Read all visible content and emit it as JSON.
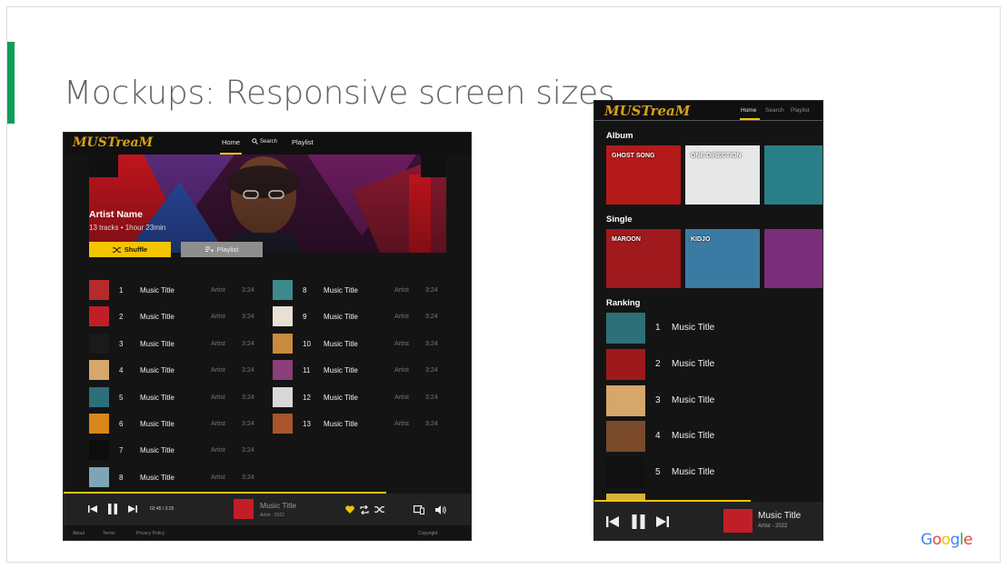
{
  "slide": {
    "title": "Mockups: Responsive screen sizes",
    "accent_color": "#0f9d58",
    "google_logo": "Google"
  },
  "desktop": {
    "logo": "MUSTreaM",
    "nav": {
      "home": "Home",
      "search": "Search",
      "playlist": "Playlist",
      "active": "Home"
    },
    "artist": {
      "name": "Artist Name",
      "tracks": "13 tracks",
      "duration": "1hour 23min"
    },
    "buttons": {
      "shuffle": "Shuffle",
      "playlist": "Playlist"
    },
    "tracks": [
      {
        "num": "1",
        "title": "Music Title",
        "artist": "Artist",
        "duration": "3:24",
        "color": "#b52a2a"
      },
      {
        "num": "2",
        "title": "Music Title",
        "artist": "Artist",
        "duration": "3:24",
        "color": "#c21e28"
      },
      {
        "num": "3",
        "title": "Music Title",
        "artist": "Artist",
        "duration": "3:24",
        "color": "#1a1a1a"
      },
      {
        "num": "4",
        "title": "Music Title",
        "artist": "Artist",
        "duration": "3:24",
        "color": "#d6a66a"
      },
      {
        "num": "5",
        "title": "Music Title",
        "artist": "Artist",
        "duration": "3:24",
        "color": "#2c6f7a"
      },
      {
        "num": "6",
        "title": "Music Title",
        "artist": "Artist",
        "duration": "3:24",
        "color": "#d9871a"
      },
      {
        "num": "7",
        "title": "Music Title",
        "artist": "Artist",
        "duration": "3:24",
        "color": "#0d0d0d"
      },
      {
        "num": "8",
        "title": "Music Title",
        "artist": "Artist",
        "duration": "3:24",
        "color": "#7fa3b8"
      },
      {
        "num": "8",
        "title": "Music Title",
        "artist": "Artist",
        "duration": "3:24",
        "color": "#3d8a8c"
      },
      {
        "num": "9",
        "title": "Music Title",
        "artist": "Artist",
        "duration": "3:24",
        "color": "#e8e0d5"
      },
      {
        "num": "10",
        "title": "Music Title",
        "artist": "Artist",
        "duration": "3:24",
        "color": "#c98a3e"
      },
      {
        "num": "11",
        "title": "Music Title",
        "artist": "Artist",
        "duration": "3:24",
        "color": "#8a3e7a"
      },
      {
        "num": "12",
        "title": "Music Title",
        "artist": "Artist",
        "duration": "3:24",
        "color": "#d8d8d8"
      },
      {
        "num": "13",
        "title": "Music Title",
        "artist": "Artist",
        "duration": "3:24",
        "color": "#a8552a"
      }
    ],
    "player": {
      "time": "02:45 / 3:25",
      "title": "Music Title",
      "subtitle": "Artist - 2022"
    },
    "footer": {
      "about": "About",
      "terms": "Terms",
      "privacy": "Privacy Policy",
      "copyright": "Copyright"
    }
  },
  "mobile": {
    "logo": "MUSTreaM",
    "nav": {
      "home": "Home",
      "search": "Search",
      "playlist": "Playlist"
    },
    "sections": {
      "album": "Album",
      "single": "Single",
      "ranking": "Ranking"
    },
    "album_tiles": [
      {
        "label": "GHOST SONG",
        "color": "#b51a1a"
      },
      {
        "label": "ONE DIRECTION",
        "color": "#e7e7e7"
      },
      {
        "label": "",
        "color": "#2a7e87"
      }
    ],
    "single_tiles": [
      {
        "label": "MAROON",
        "color": "#a0191d"
      },
      {
        "label": "KIDJO",
        "color": "#3b7ba3"
      },
      {
        "label": "",
        "color": "#7a2e7a"
      }
    ],
    "ranking": [
      {
        "num": "1",
        "title": "Music Title",
        "color": "#2e6f7a"
      },
      {
        "num": "2",
        "title": "Music Title",
        "color": "#9e1a1a"
      },
      {
        "num": "3",
        "title": "Music Title",
        "color": "#d6a66a"
      },
      {
        "num": "4",
        "title": "Music Title",
        "color": "#7a4a2a"
      },
      {
        "num": "5",
        "title": "Music Title",
        "color": "#111111"
      }
    ],
    "player": {
      "title": "Music Title",
      "subtitle": "Artist - 2022"
    }
  },
  "colors": {
    "accent_yellow": "#f5c400",
    "dark_bg": "#141414",
    "player_bg": "#222222"
  }
}
